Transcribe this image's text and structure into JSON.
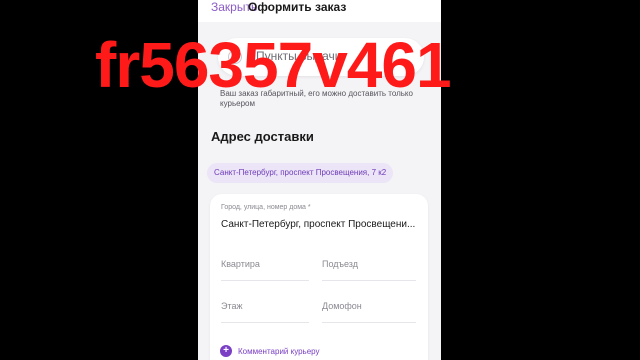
{
  "header": {
    "close_label": "Закрыть",
    "title": "Оформить заказ"
  },
  "pickup": {
    "label": "Пункты выдачи",
    "selected": false
  },
  "oversize_note": "Ваш заказ габаритный, его можно доставить только курьером",
  "delivery": {
    "section_title": "Адрес доставки",
    "suggested_address": "Санкт-Петербург, проспект Просвещения, 7 к2",
    "fields": {
      "city_label": "Город, улица, номер дома *",
      "city_value": "Санкт-Петербург, проспект Просвещени...",
      "apartment_placeholder": "Квартира",
      "entrance_placeholder": "Подъезд",
      "floor_placeholder": "Этаж",
      "intercom_placeholder": "Домофон"
    },
    "comment_label": "Комментарий курьеру"
  },
  "overlay": {
    "watermark_text": "fr56357v461"
  },
  "colors": {
    "accent": "#7a3fc4",
    "chip_bg": "#ece4f7",
    "watermark": "#ff1a1a",
    "background": "#000000"
  },
  "icons": {
    "comment_add": "plus-icon"
  }
}
